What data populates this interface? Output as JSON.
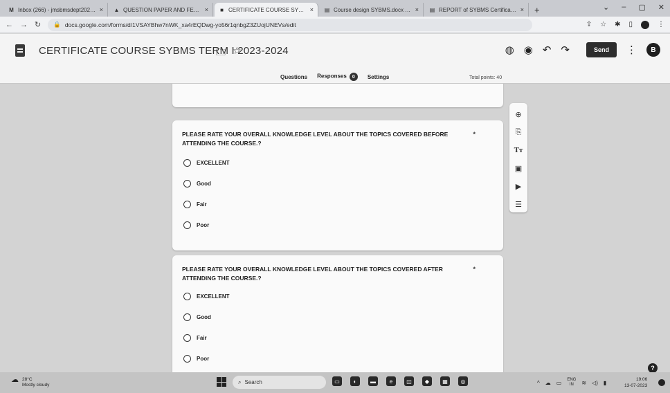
{
  "browser": {
    "tabs": [
      {
        "label": "Inbox (266) - jmsbmsdept2021@",
        "icon": "M",
        "active": false
      },
      {
        "label": "QUESTION PAPER AND FEEDBAC",
        "icon": "drive",
        "active": false
      },
      {
        "label": "CERTIFICATE COURSE SYBMS TEI",
        "icon": "forms",
        "active": true
      },
      {
        "label": "Course design SYBMS.docx - Go",
        "icon": "docs",
        "active": false
      },
      {
        "label": "REPORT of SYBMS Certificate Co",
        "icon": "docs",
        "active": false
      }
    ],
    "new_tab": "+",
    "url": "docs.google.com/forms/d/1VSAYBhw7nWK_xa4rEQDwg-yo56r1qnbgZ3ZUojUNEVs/edit"
  },
  "form": {
    "title": "CERTIFICATE COURSE SYBMS TERM I 2023-2024",
    "send_label": "Send",
    "avatar_letter": "B",
    "tabs": [
      "Questions",
      "Responses",
      "Settings"
    ],
    "responses_count": "0",
    "total_points": "Total points: 40"
  },
  "questions": [
    {
      "title": "PLEASE RATE YOUR OVERALL KNOWLEDGE LEVEL ABOUT THE TOPICS COVERED BEFORE ATTENDING THE COURSE.?",
      "required": "*",
      "options": [
        "EXCELLENT",
        "Good",
        "Fair",
        "Poor"
      ]
    },
    {
      "title": "PLEASE RATE YOUR OVERALL KNOWLEDGE LEVEL ABOUT THE TOPICS COVERED AFTER ATTENDING THE COURSE.?",
      "required": "*",
      "options": [
        "EXCELLENT",
        "Good",
        "Fair",
        "Poor"
      ]
    }
  ],
  "side_toolbar": [
    "add-question-icon",
    "import-questions-icon",
    "add-title-icon",
    "add-image-icon",
    "add-video-icon",
    "add-section-icon"
  ],
  "taskbar": {
    "weather_temp": "28°C",
    "weather_desc": "Mostly cloudy",
    "search_label": "Search",
    "lang_top": "ENG",
    "lang_bottom": "IN",
    "time": "19:06",
    "date": "13-07-2023"
  }
}
